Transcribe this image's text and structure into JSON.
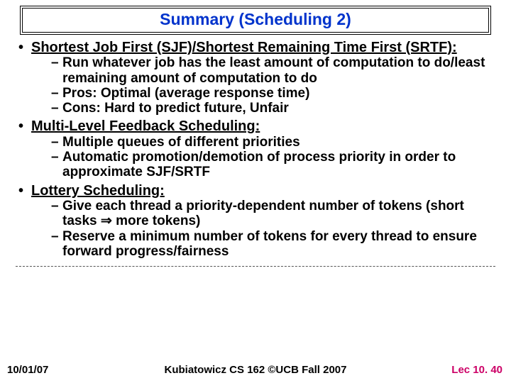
{
  "title": "Summary (Scheduling 2)",
  "items": [
    {
      "heading": "Shortest Job First (SJF)/Shortest Remaining Time First (SRTF):",
      "subs": [
        "Run whatever job has the least amount of computation to do/least remaining amount of computation to do",
        "Pros: Optimal (average response time)",
        "Cons: Hard to predict future, Unfair"
      ]
    },
    {
      "heading": "Multi-Level Feedback Scheduling:",
      "subs": [
        "Multiple queues of different priorities",
        "Automatic promotion/demotion of process priority in order to approximate SJF/SRTF"
      ]
    },
    {
      "heading": "Lottery Scheduling:",
      "subs": [
        "Give each thread a priority-dependent number of tokens (short tasks ⇒ more tokens)",
        "Reserve a minimum number of tokens for every thread to ensure forward progress/fairness"
      ]
    }
  ],
  "footer": {
    "date": "10/01/07",
    "center": "Kubiatowicz CS 162 ©UCB Fall 2007",
    "right": "Lec 10. 40"
  }
}
